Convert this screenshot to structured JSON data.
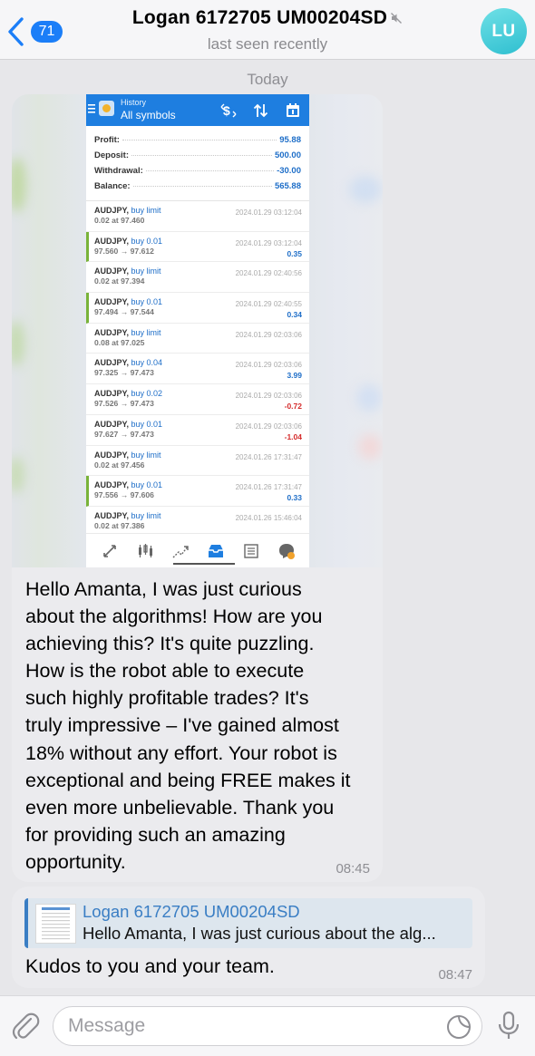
{
  "header": {
    "back_badge": "71",
    "title": "Logan 6172705 UM00204SD",
    "status": "last seen recently",
    "avatar_initials": "LU"
  },
  "date_label": "Today",
  "screenshot": {
    "header_small": "History",
    "header_title": "All symbols",
    "summary": [
      {
        "label": "Profit:",
        "value": "95.88"
      },
      {
        "label": "Deposit:",
        "value": "500.00"
      },
      {
        "label": "Withdrawal:",
        "value": "-30.00"
      },
      {
        "label": "Balance:",
        "value": "565.88"
      }
    ],
    "rows": [
      {
        "symbol": "AUDJPY,",
        "type": "buy limit",
        "detail": "0.02 at 97.460",
        "time": "2024.01.29 03:12:04",
        "profit": "",
        "filled": false
      },
      {
        "symbol": "AUDJPY,",
        "type": "buy 0.01",
        "detail": "97.560 → 97.612",
        "time": "2024.01.29 03:12:04",
        "profit": "0.35",
        "filled": true
      },
      {
        "symbol": "AUDJPY,",
        "type": "buy limit",
        "detail": "0.02 at 97.394",
        "time": "2024.01.29 02:40:56",
        "profit": "",
        "filled": false
      },
      {
        "symbol": "AUDJPY,",
        "type": "buy 0.01",
        "detail": "97.494 → 97.544",
        "time": "2024.01.29 02:40:55",
        "profit": "0.34",
        "filled": true
      },
      {
        "symbol": "AUDJPY,",
        "type": "buy limit",
        "detail": "0.08 at 97.025",
        "time": "2024.01.29 02:03:06",
        "profit": "",
        "filled": false
      },
      {
        "symbol": "AUDJPY,",
        "type": "buy 0.04",
        "detail": "97.325 → 97.473",
        "time": "2024.01.29 02:03:06",
        "profit": "3.99",
        "filled": false
      },
      {
        "symbol": "AUDJPY,",
        "type": "buy 0.02",
        "detail": "97.526 → 97.473",
        "time": "2024.01.29 02:03:06",
        "profit": "-0.72",
        "filled": false
      },
      {
        "symbol": "AUDJPY,",
        "type": "buy 0.01",
        "detail": "97.627 → 97.473",
        "time": "2024.01.29 02:03:06",
        "profit": "-1.04",
        "filled": false
      },
      {
        "symbol": "AUDJPY,",
        "type": "buy limit",
        "detail": "0.02 at 97.456",
        "time": "2024.01.26 17:31:47",
        "profit": "",
        "filled": false
      },
      {
        "symbol": "AUDJPY,",
        "type": "buy 0.01",
        "detail": "97.556 → 97.606",
        "time": "2024.01.26 17:31:47",
        "profit": "0.33",
        "filled": true
      },
      {
        "symbol": "AUDJPY,",
        "type": "buy limit",
        "detail": "0.02 at 97.386",
        "time": "2024.01.26 15:46:04",
        "profit": "",
        "filled": false
      }
    ]
  },
  "message1": {
    "text": "Hello Amanta, I was just curious\nabout the algorithms! How are you\nachieving this? It's quite puzzling.\nHow is the robot able to execute\nsuch highly profitable trades? It's\ntruly impressive – I've gained almost\n18% without any effort. Your robot is\nexceptional and being FREE makes it\neven more unbelievable. Thank you\nfor providing such an amazing\nopportunity.",
    "time": "08:45"
  },
  "message2": {
    "reply_name": "Logan 6172705 UM00204SD",
    "reply_text": "Hello Amanta, I was just curious about the alg...",
    "text": "Kudos to you and your team.",
    "time": "08:47"
  },
  "composer": {
    "placeholder": "Message"
  },
  "colors": {
    "accent": "#1b7ef8",
    "avatar": "#3fc9d8",
    "mt_header": "#1e7ee0",
    "profit_positive": "#1e6ec8",
    "profit_negative": "#d52b2b",
    "reply_accent": "#3a7ec4"
  },
  "icons": [
    "chevron-left-icon",
    "mute-icon",
    "attach-icon",
    "sticker-icon",
    "mic-icon"
  ]
}
